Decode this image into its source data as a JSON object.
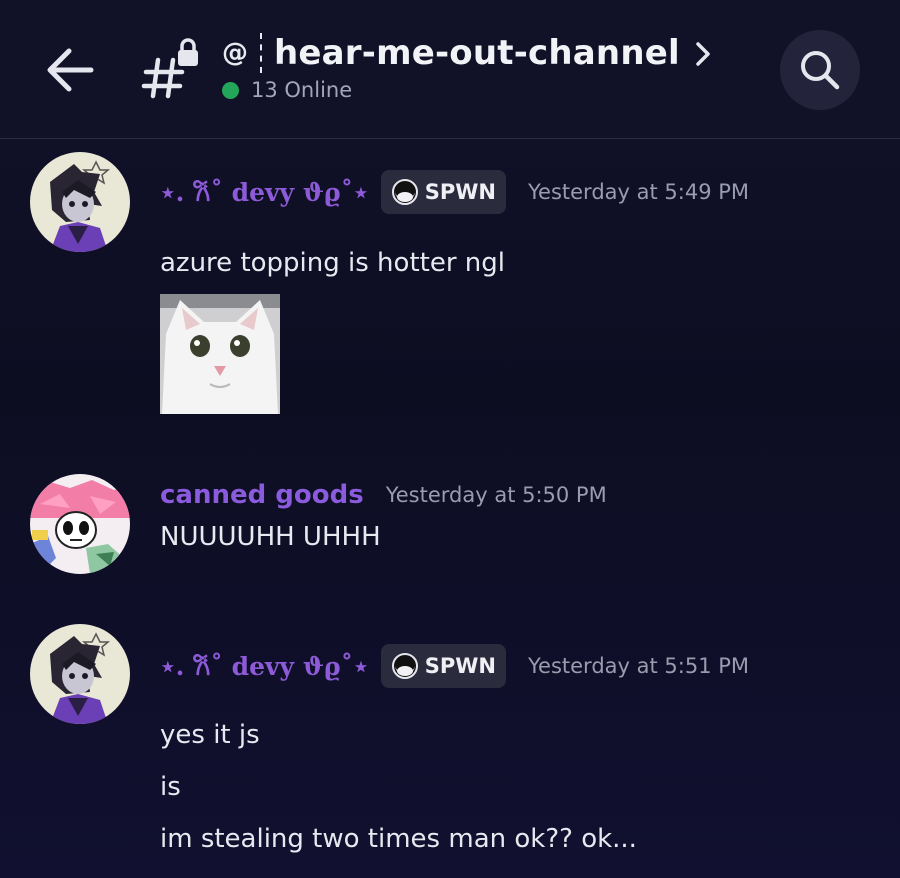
{
  "header": {
    "channel_prefix": "@",
    "channel_name": "hear-me-out-channel",
    "online_text": "13 Online"
  },
  "messages": [
    {
      "author": "⋆. 𐙚˚ devy ϑϱ˚⋆",
      "tag": "SPWN",
      "timestamp": "Yesterday at 5:49 PM",
      "lines": [
        "azure topping is hotter ngl"
      ],
      "has_image": true
    },
    {
      "author": "canned goods",
      "timestamp": "Yesterday at 5:50 PM",
      "lines": [
        "NUUUUHH UHHH"
      ]
    },
    {
      "author": "⋆. 𐙚˚ devy ϑϱ˚⋆",
      "tag": "SPWN",
      "timestamp": "Yesterday at 5:51 PM",
      "lines": [
        "yes it js",
        "is",
        "im stealing two times man ok?? ok..."
      ]
    }
  ],
  "colors": {
    "background": "#0f0f24",
    "header": "#111128",
    "username": "#8e5bd8",
    "online": "#23a55a",
    "tag_bg": "#2a2b3d",
    "timestamp": "#9a9cae"
  },
  "icons": {
    "back": "arrow-left-icon",
    "channel": "hashtag-lock-icon",
    "chevron": "chevron-right-icon",
    "search": "search-icon",
    "tag": "guild-tag-icon"
  }
}
